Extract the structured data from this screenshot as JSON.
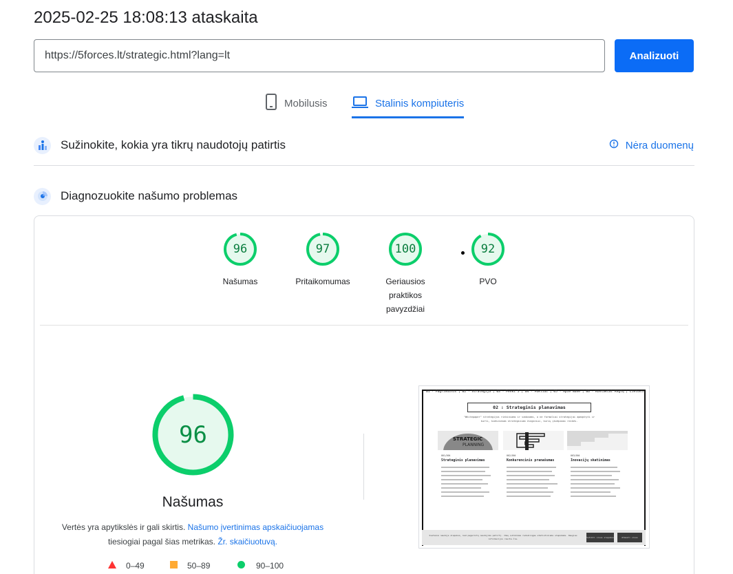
{
  "report": {
    "title": "2025-02-25 18:08:13 ataskaita"
  },
  "url_bar": {
    "value": "https://5forces.lt/strategic.html?lang=lt",
    "analyze_label": "Analizuoti"
  },
  "tabs": [
    {
      "label": "Mobilusis",
      "icon": "smartphone-icon",
      "active": false
    },
    {
      "label": "Stalinis kompiuteris",
      "icon": "laptop-icon",
      "active": true
    }
  ],
  "crux": {
    "title": "Sužinokite, kokia yra tikrų naudotojų patirtis",
    "status": "Nėra duomenų",
    "icon": "crux-icon",
    "status_icon": "info-icon"
  },
  "diagnose": {
    "title": "Diagnozuokite našumo problemas",
    "icon": "lighthouse-icon"
  },
  "scores": [
    {
      "value": 96,
      "label": "Našumas"
    },
    {
      "value": 97,
      "label": "Pritaikomumas"
    },
    {
      "value": 100,
      "label": "Geriausios praktikos pavyzdžiai"
    },
    {
      "value": 92,
      "label": "PVO"
    }
  ],
  "performance": {
    "score": 96,
    "title": "Našumas",
    "desc_prefix": "Vertės yra apytikslės ir gali skirtis.",
    "desc_link1": "Našumo įvertinimas apskaičiuojamas",
    "desc_middle": "tiesiogiai pagal šias metrikas.",
    "desc_link2": "Žr. skaičiuotuvą."
  },
  "legend": [
    {
      "range": "0–49",
      "shape": "triangle",
      "color": "#ff3333"
    },
    {
      "range": "50–89",
      "shape": "square",
      "color": "#ffaa33"
    },
    {
      "range": "90–100",
      "shape": "circle",
      "color": "#0cce6b"
    }
  ],
  "colors": {
    "accent": "#1a73e8",
    "pass": "#0cce6b",
    "pass_fill": "#e6f9ee",
    "pass_text": "#0a7d3e"
  },
  "screenshot": {
    "nav": "01 · Pagrindinis | 02 · Strategija | 03 · Penki 5 | 04 · Pokliai | 05 · Apie mane | 06 · Kontaktai      Anglų | Lietuvių",
    "heading": "02 : Strateginis planavimas",
    "subtitle": "\"Whitepaper\" strategijos rinkiniams ir vadovams, o ne formaliai strategijai apmąstyti ir kurti, kiekvienam strateginiam žingsniui, kurių įkvėpimai reikės.",
    "cards": [
      {
        "no": "001/004",
        "title": "Strateginis planavimas"
      },
      {
        "no": "002/004",
        "title": "Konkurencinis pranašumas"
      },
      {
        "no": "003/004",
        "title": "Inovacijų skatinimas"
      }
    ],
    "cookie_text": "Svetainė naudoja slapukus, kad pagerintų naudojimo patirtį. Jūsų sutikimas reikalingas statistiniams slapukams. Daugiau informacijos rasite čia.",
    "cookie_accept": "Sutikti visus slapukus",
    "cookie_reject": "Atmesti visus"
  }
}
